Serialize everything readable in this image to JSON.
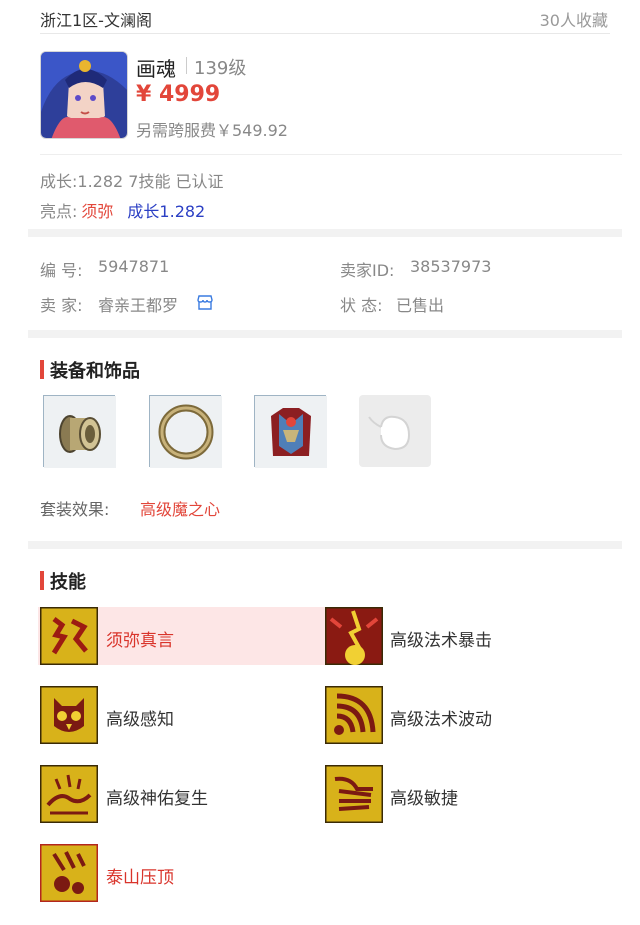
{
  "header": {
    "server": "浙江1区-文澜阁",
    "favorites": "30人收藏"
  },
  "role": {
    "avatar_icon": "character-portrait",
    "name": "画魂",
    "level": "139级",
    "price": "¥ 4999",
    "fee": "另需跨服费￥549.92"
  },
  "summary": {
    "growth_line": "成长:1.282 7技能 已认证",
    "highlight_label": "亮点:",
    "highlight_tag1": "须弥",
    "highlight_tag2": "成长1.282"
  },
  "info": {
    "id_label": "编 号:",
    "id_value": "5947871",
    "seller_id_label": "卖家ID:",
    "seller_id_value": "38537973",
    "seller_label": "卖 家:",
    "seller_value": "睿亲王都罗",
    "seller_icon": "shop-icon",
    "status_label": "状 态:",
    "status_value": "已售出"
  },
  "equipment": {
    "title": "装备和饰品",
    "items": [
      {
        "icon": "bracer-icon"
      },
      {
        "icon": "ring-icon"
      },
      {
        "icon": "armor-icon"
      },
      {
        "icon": "empty-slot-icon"
      }
    ],
    "set_label": "套装效果:",
    "set_value": "高级魔之心"
  },
  "skills": {
    "title": "技能",
    "items": [
      {
        "label": "须弥真言",
        "icon": "sumeru-skill-icon",
        "highlight": true
      },
      {
        "label": "高级法术暴击",
        "icon": "spell-crit-skill-icon",
        "highlight": false
      },
      {
        "label": "高级感知",
        "icon": "owl-skill-icon",
        "highlight": false
      },
      {
        "label": "高级法术波动",
        "icon": "wave-skill-icon",
        "highlight": false
      },
      {
        "label": "高级神佑复生",
        "icon": "revive-skill-icon",
        "highlight": false
      },
      {
        "label": "高级敏捷",
        "icon": "agility-skill-icon",
        "highlight": false
      },
      {
        "label": "泰山压顶",
        "icon": "taishan-skill-icon",
        "highlight": true
      }
    ]
  },
  "colors": {
    "accent": "#e2463a",
    "blue_tag": "#2b3fc4",
    "skill_gold": "#d8b21a"
  }
}
